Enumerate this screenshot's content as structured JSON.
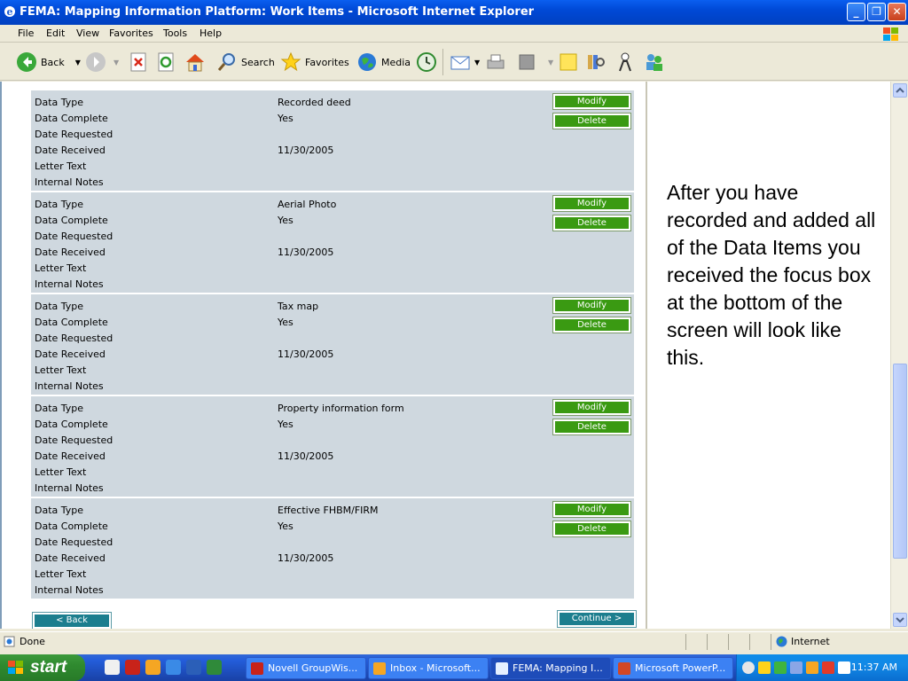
{
  "window": {
    "title": "FEMA: Mapping Information Platform: Work Items - Microsoft Internet Explorer"
  },
  "menu": [
    "File",
    "Edit",
    "View",
    "Favorites",
    "Tools",
    "Help"
  ],
  "toolbar": {
    "back": "Back",
    "search": "Search",
    "favorites": "Favorites",
    "media": "Media"
  },
  "labels": [
    "Data Type",
    "Data Complete",
    "Date Requested",
    "Date Received",
    "Letter Text",
    "Internal Notes"
  ],
  "records": [
    {
      "type": "Recorded deed",
      "complete": "Yes",
      "received": "11/30/2005"
    },
    {
      "type": "Aerial Photo",
      "complete": "Yes",
      "received": "11/30/2005"
    },
    {
      "type": "Tax map",
      "complete": "Yes",
      "received": "11/30/2005"
    },
    {
      "type": "Property information form",
      "complete": "Yes",
      "received": "11/30/2005"
    },
    {
      "type": "Effective FHBM/FIRM",
      "complete": "Yes",
      "received": "11/30/2005"
    }
  ],
  "buttons": {
    "modify": "Modify",
    "delete": "Delete",
    "back": "< Back",
    "continue": "Continue >"
  },
  "note": "After you have recorded and added all of the Data Items you received the focus box at the bottom of the screen will look like this.",
  "status": {
    "text": "Done",
    "zone": "Internet"
  },
  "taskbar": {
    "start": "start",
    "tasks": [
      "Novell GroupWis...",
      "Inbox - Microsoft...",
      "FEMA: Mapping I...",
      "Microsoft PowerP..."
    ],
    "clock": "11:37 AM"
  },
  "colors": {
    "record_bg": "#cfd8df",
    "action_green": "#3a9a12",
    "nav_teal": "#1c7e8e",
    "titlebar_blue": "#0a5ff0"
  }
}
